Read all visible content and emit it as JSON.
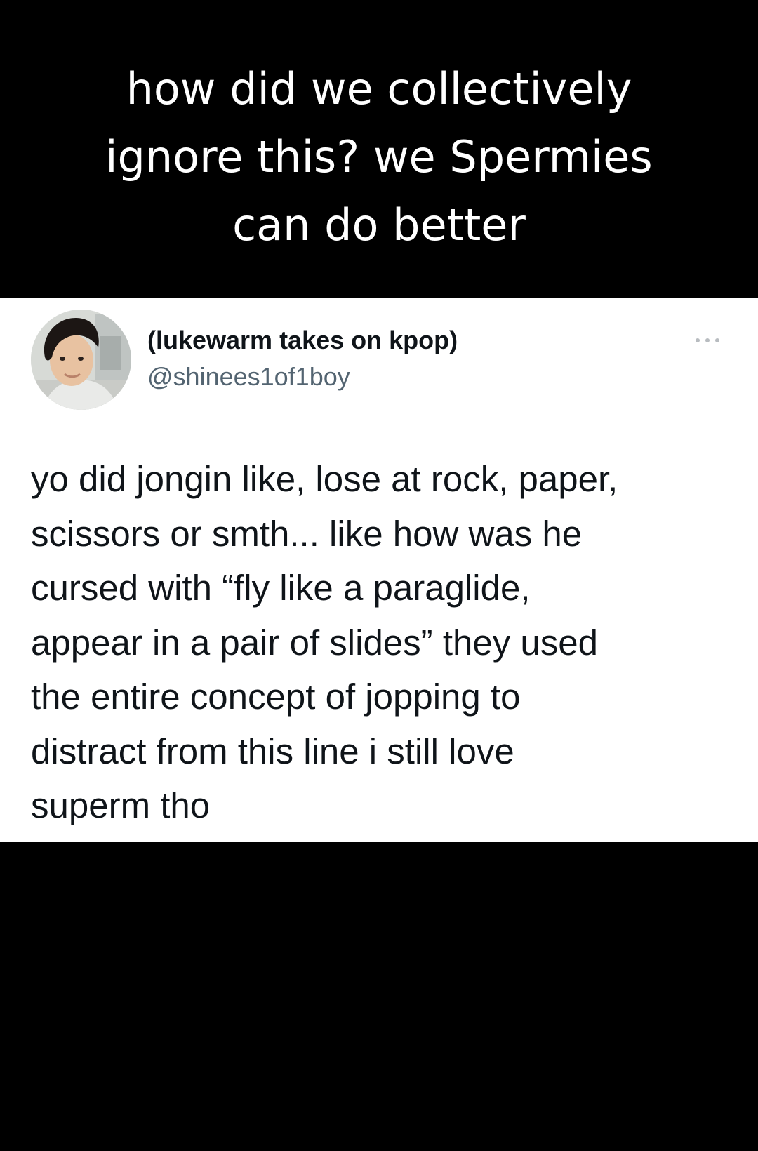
{
  "caption": {
    "lines": [
      "how did we collectively",
      "ignore this?  we Spermies",
      "can do better"
    ]
  },
  "tweet": {
    "display_name": "(lukewarm takes on kpop)",
    "handle": "@shinees1of1boy",
    "more_icon": "more-horizontal-icon",
    "avatar_icon": "profile-photo",
    "text_lines": [
      "yo did jongin like, lose at rock, paper,",
      "scissors or smth...  like how was he",
      "cursed with “fly like a paraglide,",
      "appear in a pair of slides” they used",
      "the entire concept of jopping to",
      "distract from this line i still love",
      "superm tho"
    ]
  },
  "colors": {
    "background": "#000000",
    "card": "#ffffff",
    "caption_text": "#ffffff",
    "tweet_text": "#0f1419",
    "handle_text": "#536471",
    "more_icon": "#b8bcc0"
  }
}
